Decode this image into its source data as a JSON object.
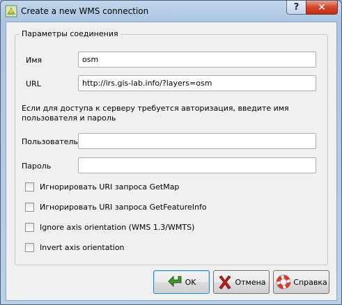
{
  "window": {
    "title": "Create a new WMS connection",
    "help_glyph": "?",
    "close_glyph": "✕"
  },
  "group": {
    "title": "Параметры соединения"
  },
  "fields": {
    "name_label": "Имя",
    "name_value": "osm",
    "url_label": "URL",
    "url_value": "http://irs.gis-lab.info/?layers=osm",
    "auth_note": "Если для доступа к серверу требуется авторизация, введите имя пользователя и пароль",
    "user_label": "Пользователь",
    "user_value": "",
    "password_label": "Пароль",
    "password_value": ""
  },
  "checkboxes": [
    {
      "label": "Игнорировать URI запроса GetMap",
      "checked": false
    },
    {
      "label": "Игнорировать URI запроса GetFeatureInfo",
      "checked": false
    },
    {
      "label": "Ignore axis orientation (WMS 1.3/WMTS)",
      "checked": false
    },
    {
      "label": "Invert axis orientation",
      "checked": false
    }
  ],
  "buttons": {
    "ok_label": "OK",
    "cancel_label": "Отмена",
    "help_label": "Справка"
  },
  "icons": {
    "app": "qgis-wms-icon",
    "ok": "green-arrow-icon",
    "cancel": "red-x-icon",
    "help": "lifebuoy-icon"
  },
  "colors": {
    "ok_arrow": "#3f9a2c",
    "cancel_x": "#b82020",
    "help_ring": "#d83a2a"
  }
}
